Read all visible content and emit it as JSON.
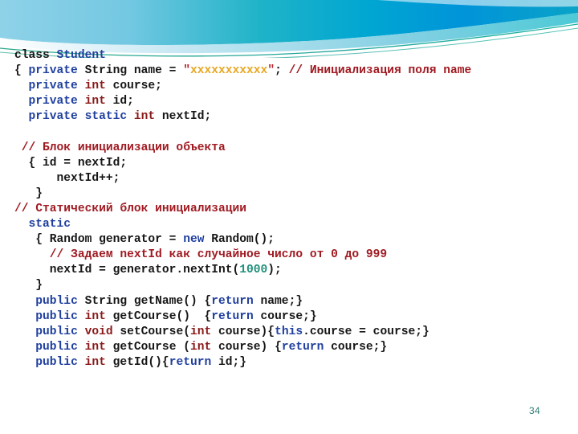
{
  "slide": {
    "number": "34",
    "background_color": "#ffffff"
  },
  "theme": {
    "name": "flow-banner",
    "accent_deep_cyan": "#0096d6",
    "accent_teal": "#00a8b5",
    "accent_light_blue": "#7ecbe4",
    "accent_pale": "#b9e2ef",
    "accent_line_green": "#2aa87f",
    "slide_number_color": "#2e7d73"
  },
  "syntax_colors": {
    "plain": "#161616",
    "keyword": "#1f3f9e",
    "type": "#8b1a1a",
    "string": "#e8a723",
    "quote": "#b8252b",
    "comment": "#a01a22",
    "number": "#1f8f7a"
  },
  "code": {
    "language": "java",
    "lines": [
      {
        "id": "line-class-decl",
        "tokens": [
          {
            "t": "class ",
            "c": "plain"
          },
          {
            "t": "Student",
            "c": "keyword"
          }
        ]
      },
      {
        "id": "line-field-name",
        "tokens": [
          {
            "t": "{ ",
            "c": "plain"
          },
          {
            "t": "private",
            "c": "keyword"
          },
          {
            "t": " String name = ",
            "c": "plain"
          },
          {
            "t": "\"",
            "c": "quote"
          },
          {
            "t": "xxxxxxxxxxx",
            "c": "string"
          },
          {
            "t": "\"",
            "c": "quote"
          },
          {
            "t": "; ",
            "c": "plain"
          },
          {
            "t": "// Инициализация поля name",
            "c": "comment"
          }
        ]
      },
      {
        "id": "line-field-course",
        "tokens": [
          {
            "t": "  ",
            "c": "plain"
          },
          {
            "t": "private",
            "c": "keyword"
          },
          {
            "t": " ",
            "c": "plain"
          },
          {
            "t": "int",
            "c": "type"
          },
          {
            "t": " course;",
            "c": "plain"
          }
        ]
      },
      {
        "id": "line-field-id",
        "tokens": [
          {
            "t": "  ",
            "c": "plain"
          },
          {
            "t": "private",
            "c": "keyword"
          },
          {
            "t": " ",
            "c": "plain"
          },
          {
            "t": "int",
            "c": "type"
          },
          {
            "t": " id;",
            "c": "plain"
          }
        ]
      },
      {
        "id": "line-field-nextid",
        "tokens": [
          {
            "t": "  ",
            "c": "plain"
          },
          {
            "t": "private static",
            "c": "keyword"
          },
          {
            "t": " ",
            "c": "plain"
          },
          {
            "t": "int",
            "c": "type"
          },
          {
            "t": " nextId;",
            "c": "plain"
          }
        ]
      },
      {
        "id": "line-blank-1",
        "tokens": [
          {
            "t": " ",
            "c": "plain"
          }
        ]
      },
      {
        "id": "line-comment-instance-block",
        "tokens": [
          {
            "t": " ",
            "c": "plain"
          },
          {
            "t": "// Блок инициализации объекта",
            "c": "comment"
          }
        ]
      },
      {
        "id": "line-instance-block-open",
        "tokens": [
          {
            "t": "  { id = nextId;",
            "c": "plain"
          }
        ]
      },
      {
        "id": "line-nextid-increment",
        "tokens": [
          {
            "t": "      nextId++;",
            "c": "plain"
          }
        ]
      },
      {
        "id": "line-instance-block-close",
        "tokens": [
          {
            "t": "   }",
            "c": "plain"
          }
        ]
      },
      {
        "id": "line-comment-static-block",
        "tokens": [
          {
            "t": "// Статический блок инициализации",
            "c": "comment"
          }
        ]
      },
      {
        "id": "line-static-keyword",
        "tokens": [
          {
            "t": "  ",
            "c": "plain"
          },
          {
            "t": "static",
            "c": "keyword"
          }
        ]
      },
      {
        "id": "line-random-generator",
        "tokens": [
          {
            "t": "   { Random generator = ",
            "c": "plain"
          },
          {
            "t": "new",
            "c": "keyword"
          },
          {
            "t": " Random();",
            "c": "plain"
          }
        ]
      },
      {
        "id": "line-comment-random-range",
        "tokens": [
          {
            "t": "     ",
            "c": "plain"
          },
          {
            "t": "// Задаем nextId как случайное число от 0 до 999",
            "c": "comment"
          }
        ]
      },
      {
        "id": "line-nextid-assign",
        "tokens": [
          {
            "t": "     nextId = generator.nextInt(",
            "c": "plain"
          },
          {
            "t": "1000",
            "c": "number"
          },
          {
            "t": ");",
            "c": "plain"
          }
        ]
      },
      {
        "id": "line-static-block-close",
        "tokens": [
          {
            "t": "   }",
            "c": "plain"
          }
        ]
      },
      {
        "id": "line-get-name",
        "tokens": [
          {
            "t": "   ",
            "c": "plain"
          },
          {
            "t": "public",
            "c": "keyword"
          },
          {
            "t": " String getName() {",
            "c": "plain"
          },
          {
            "t": "return",
            "c": "keyword"
          },
          {
            "t": " name;}",
            "c": "plain"
          }
        ]
      },
      {
        "id": "line-get-course",
        "tokens": [
          {
            "t": "   ",
            "c": "plain"
          },
          {
            "t": "public",
            "c": "keyword"
          },
          {
            "t": " ",
            "c": "plain"
          },
          {
            "t": "int",
            "c": "type"
          },
          {
            "t": " getCourse()  {",
            "c": "plain"
          },
          {
            "t": "return",
            "c": "keyword"
          },
          {
            "t": " course;}",
            "c": "plain"
          }
        ]
      },
      {
        "id": "line-set-course",
        "tokens": [
          {
            "t": "   ",
            "c": "plain"
          },
          {
            "t": "public",
            "c": "keyword"
          },
          {
            "t": " ",
            "c": "plain"
          },
          {
            "t": "void",
            "c": "type"
          },
          {
            "t": " setCourse(",
            "c": "plain"
          },
          {
            "t": "int",
            "c": "type"
          },
          {
            "t": " course){",
            "c": "plain"
          },
          {
            "t": "this",
            "c": "keyword"
          },
          {
            "t": ".course = course;}",
            "c": "plain"
          }
        ]
      },
      {
        "id": "line-get-course-overload",
        "tokens": [
          {
            "t": "   ",
            "c": "plain"
          },
          {
            "t": "public",
            "c": "keyword"
          },
          {
            "t": " ",
            "c": "plain"
          },
          {
            "t": "int",
            "c": "type"
          },
          {
            "t": " getCourse (",
            "c": "plain"
          },
          {
            "t": "int",
            "c": "type"
          },
          {
            "t": " course) {",
            "c": "plain"
          },
          {
            "t": "return",
            "c": "keyword"
          },
          {
            "t": " course;}",
            "c": "plain"
          }
        ]
      },
      {
        "id": "line-get-id",
        "tokens": [
          {
            "t": "   ",
            "c": "plain"
          },
          {
            "t": "public",
            "c": "keyword"
          },
          {
            "t": " ",
            "c": "plain"
          },
          {
            "t": "int",
            "c": "type"
          },
          {
            "t": " getId(){",
            "c": "plain"
          },
          {
            "t": "return",
            "c": "keyword"
          },
          {
            "t": " id;}",
            "c": "plain"
          }
        ]
      }
    ]
  }
}
